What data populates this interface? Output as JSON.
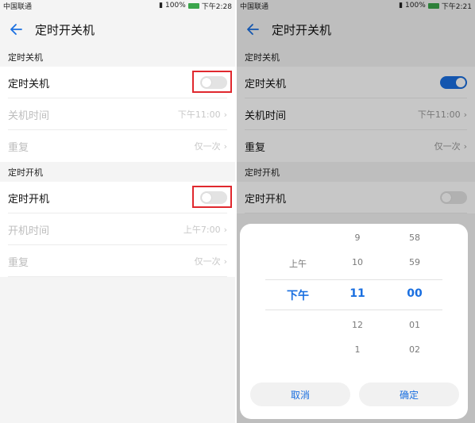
{
  "left": {
    "status": {
      "carrier": "中国联通",
      "battery": "100%",
      "time": "下午2:28"
    },
    "title": "定时开关机",
    "off_section": "定时关机",
    "off_toggle_label": "定时关机",
    "off_time_label": "关机时间",
    "off_time_value": "下午11:00",
    "off_repeat_label": "重复",
    "off_repeat_value": "仅一次",
    "on_section": "定时开机",
    "on_toggle_label": "定时开机",
    "on_time_label": "开机时间",
    "on_time_value": "上午7:00",
    "on_repeat_label": "重复",
    "on_repeat_value": "仅一次"
  },
  "right": {
    "status": {
      "carrier": "中国联通",
      "battery": "100%",
      "time": "下午2:21"
    },
    "title": "定时开关机",
    "off_section": "定时关机",
    "off_toggle_label": "定时关机",
    "off_time_label": "关机时间",
    "off_time_value": "下午11:00",
    "off_repeat_label": "重复",
    "off_repeat_value": "仅一次",
    "on_section": "定时开机",
    "on_toggle_label": "定时开机"
  },
  "picker": {
    "ampm": {
      "above": "上午",
      "selected": "下午"
    },
    "hour": {
      "above2": "9",
      "above1": "10",
      "selected": "11",
      "below1": "12",
      "below2": "1"
    },
    "minute": {
      "above2": "58",
      "above1": "59",
      "selected": "00",
      "below1": "01",
      "below2": "02"
    },
    "cancel_label": "取消",
    "confirm_label": "确定"
  },
  "colors": {
    "accent": "#1a6fe0",
    "highlight_box": "#e0282e"
  }
}
